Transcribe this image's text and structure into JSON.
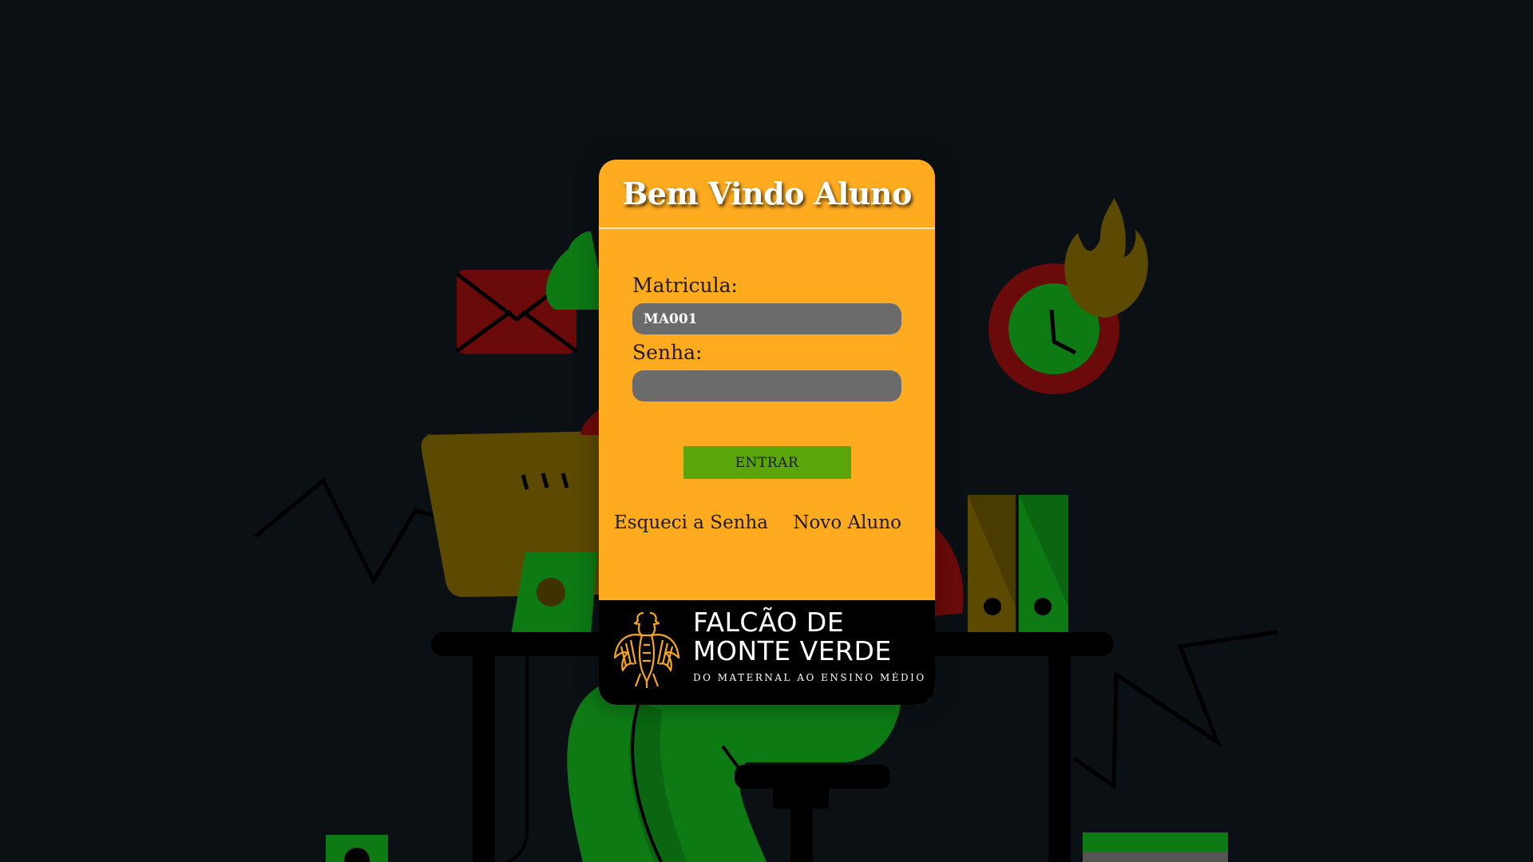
{
  "login": {
    "title": "Bem Vindo Aluno",
    "matricula_label": "Matricula:",
    "matricula_value": "MA001",
    "senha_label": "Senha:",
    "senha_value": "",
    "submit_label": "ENTRAR",
    "forgot_link": "Esqueci a Senha",
    "new_student_link": "Novo Aluno"
  },
  "brand": {
    "name": "FALCÃO DE\nMONTE VERDE",
    "tagline": "DO MATERNAL AO ENSINO MÉDIO"
  },
  "colors": {
    "background": "#0a1014",
    "card": "#ffab1f",
    "input": "#6b6b6b",
    "button": "#5aa50a",
    "brand_bar": "#000000",
    "brand_accent": "#f5a623"
  },
  "icons": {
    "background": "office-desk-illustration",
    "logo": "eagle-logo-icon"
  }
}
